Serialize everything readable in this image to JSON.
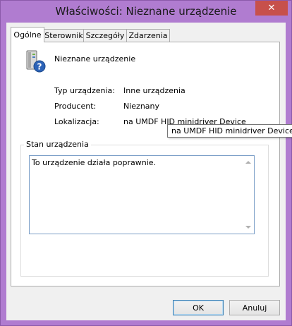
{
  "window": {
    "title": "Właściwości: Nieznane urządzenie",
    "close_glyph": "✕",
    "frame_color": "#b07cd0"
  },
  "tabs": [
    {
      "label": "Ogólne",
      "active": true
    },
    {
      "label": "Sterownik",
      "active": false
    },
    {
      "label": "Szczegóły",
      "active": false
    },
    {
      "label": "Zdarzenia",
      "active": false
    }
  ],
  "device": {
    "icon": "unknown-device-icon",
    "name": "Nieznane urządzenie",
    "properties": [
      {
        "label": "Typ urządzenia:",
        "value": "Inne urządzenia"
      },
      {
        "label": "Producent:",
        "value": "Nieznany"
      },
      {
        "label": "Lokalizacja:",
        "value": "na UMDF HID minidriver Device"
      }
    ],
    "tooltip": "na UMDF HID minidriver Device"
  },
  "status": {
    "group_label": "Stan urządzenia",
    "text": "To urządzenie działa poprawnie."
  },
  "buttons": {
    "ok": "OK",
    "cancel": "Anuluj"
  }
}
